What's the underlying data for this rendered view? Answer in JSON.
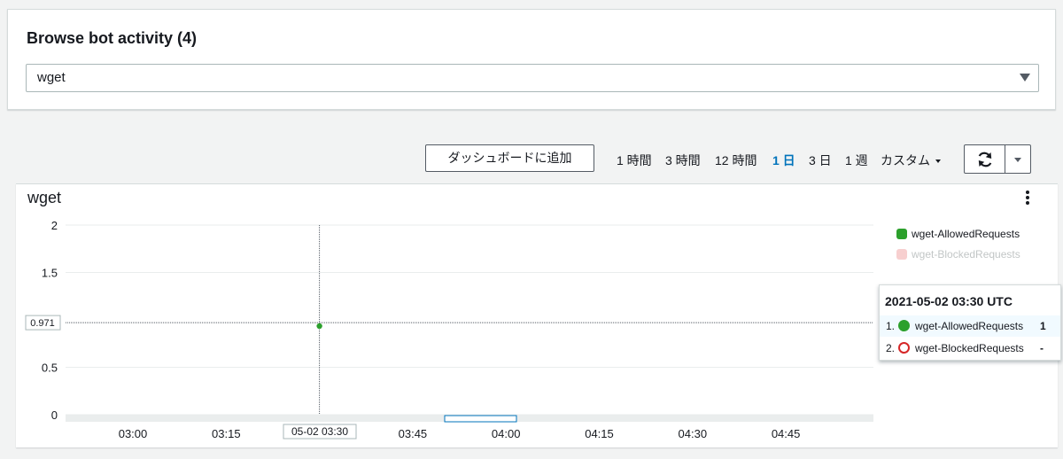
{
  "top": {
    "title": "Browse bot activity (4)",
    "select_value": "wget"
  },
  "toolbar": {
    "add_dashboard": "ダッシュボードに追加",
    "ranges": [
      {
        "label": "1 時間",
        "active": false
      },
      {
        "label": "3 時間",
        "active": false
      },
      {
        "label": "12 時間",
        "active": false
      },
      {
        "label": "1 日",
        "active": true
      },
      {
        "label": "3 日",
        "active": false
      },
      {
        "label": "1 週",
        "active": false
      },
      {
        "label": "カスタム",
        "active": false
      }
    ],
    "refresh_icon": "refresh-icon",
    "dropdown_icon": "caret-down-icon"
  },
  "chart": {
    "title": "wget",
    "menu_icon": "kebab-menu-icon",
    "crosshair_y_label": "0.971",
    "crosshair_x_label": "05-02 03:30",
    "colors": {
      "allowed": "#2ca02c",
      "blocked": "#d62728",
      "blocked_legend": "#f7cfcf"
    }
  },
  "tooltip": {
    "time": "2021-05-02 03:30 UTC",
    "rows": [
      {
        "index": "1.",
        "name": "wget-AllowedRequests",
        "value": "1"
      },
      {
        "index": "2.",
        "name": "wget-BlockedRequests",
        "value": "-"
      }
    ]
  },
  "chart_data": {
    "type": "line",
    "title": "wget",
    "x_ticks": [
      "03:00",
      "03:15",
      "03:30",
      "03:45",
      "04:00",
      "04:15",
      "04:30",
      "04:45"
    ],
    "y_ticks": [
      "0",
      "0.5",
      "1.5",
      "2"
    ],
    "ylim": [
      0,
      2
    ],
    "legend_position": "right",
    "series": [
      {
        "name": "wget-AllowedRequests",
        "color": "#2ca02c",
        "points": [
          {
            "x": "03:30",
            "y": 1
          }
        ]
      },
      {
        "name": "wget-BlockedRequests",
        "color": "#f7cfcf",
        "points": []
      }
    ],
    "grid": true
  }
}
